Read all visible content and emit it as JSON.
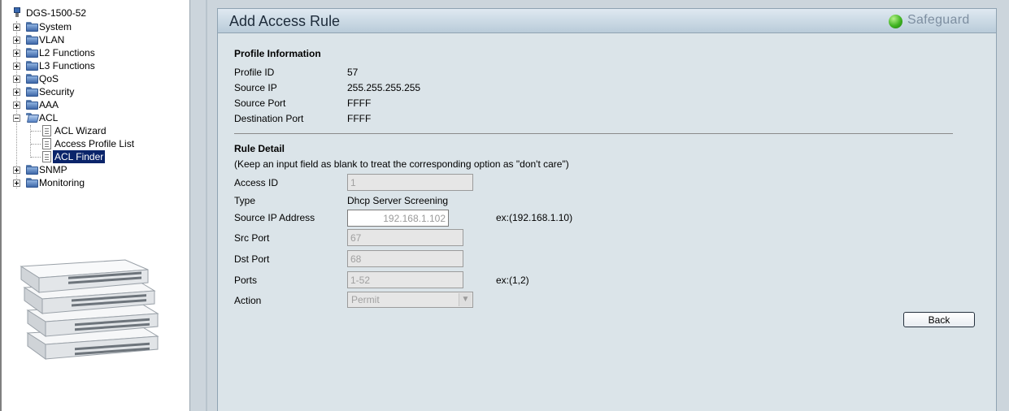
{
  "tree": {
    "root": "DGS-1500-52",
    "items": [
      {
        "label": "System"
      },
      {
        "label": "VLAN"
      },
      {
        "label": "L2 Functions"
      },
      {
        "label": "L3 Functions"
      },
      {
        "label": "QoS"
      },
      {
        "label": "Security"
      },
      {
        "label": "AAA"
      },
      {
        "label": "ACL",
        "children": [
          "ACL Wizard",
          "Access Profile List",
          "ACL Finder"
        ]
      },
      {
        "label": "SNMP"
      },
      {
        "label": "Monitoring"
      }
    ],
    "selected": "ACL Finder"
  },
  "panel": {
    "title": "Add Access Rule",
    "safeguard": "Safeguard",
    "safeguard_color": "#3fb321"
  },
  "profile_info": {
    "heading": "Profile Information",
    "rows": [
      {
        "label": "Profile ID",
        "value": "57"
      },
      {
        "label": "Source IP",
        "value": "255.255.255.255"
      },
      {
        "label": "Source Port",
        "value": "FFFF"
      },
      {
        "label": "Destination Port",
        "value": "FFFF"
      }
    ]
  },
  "rule_detail": {
    "heading": "Rule Detail",
    "hint": "(Keep an input field as blank to treat the corresponding option as \"don't care\")",
    "access_id": {
      "label": "Access ID",
      "value": "1"
    },
    "type": {
      "label": "Type",
      "value": "Dhcp Server Screening"
    },
    "source_ip": {
      "label": "Source IP Address",
      "value": "192.168.1.102",
      "example": "ex:(192.168.1.10)"
    },
    "src_port": {
      "label": "Src Port",
      "value": "67"
    },
    "dst_port": {
      "label": "Dst Port",
      "value": "68"
    },
    "ports": {
      "label": "Ports",
      "value": "1-52",
      "example": "ex:(1,2)"
    },
    "action": {
      "label": "Action",
      "value": "Permit"
    }
  },
  "buttons": {
    "back": "Back"
  }
}
